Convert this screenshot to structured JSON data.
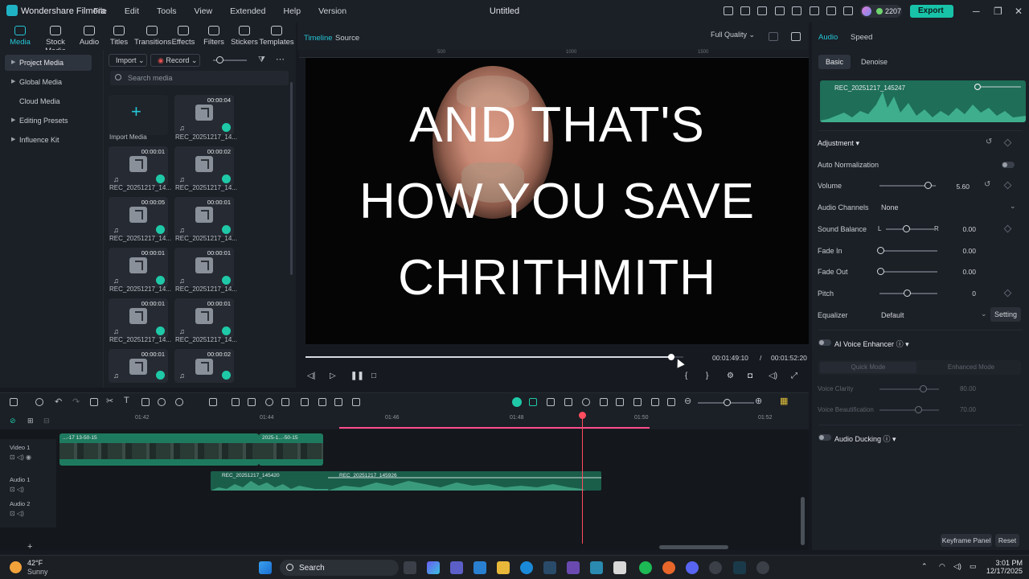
{
  "app": {
    "name": "Wondershare Filmora",
    "document_title": "Untitled",
    "menu": [
      "File",
      "Edit",
      "Tools",
      "View",
      "Extended",
      "Help",
      "Version"
    ],
    "credits": "2207",
    "export_label": "Export"
  },
  "toolbar": {
    "items": [
      "Media",
      "Stock Media",
      "Audio",
      "Titles",
      "Transitions",
      "Effects",
      "Filters",
      "Stickers",
      "Templates"
    ],
    "active": "Media"
  },
  "left_nav": {
    "items": [
      "Project Media",
      "Global Media",
      "Cloud Media",
      "Editing Presets",
      "Influence Kit"
    ]
  },
  "media": {
    "import_label": "Import",
    "record_label": "Record",
    "search_placeholder": "Search media",
    "import_tile_label": "Import Media",
    "tiles": [
      {
        "name": "REC_20251217_14...",
        "duration": "00:00:04"
      },
      {
        "name": "REC_20251217_14...",
        "duration": "00:00:01"
      },
      {
        "name": "REC_20251217_14...",
        "duration": "00:00:02"
      },
      {
        "name": "REC_20251217_14...",
        "duration": "00:00:05"
      },
      {
        "name": "REC_20251217_14...",
        "duration": "00:00:01"
      },
      {
        "name": "REC_20251217_14...",
        "duration": "00:00:01"
      },
      {
        "name": "REC_20251217_14...",
        "duration": "00:00:01"
      },
      {
        "name": "REC_20251217_14...",
        "duration": "00:00:01"
      },
      {
        "name": "REC_20251217_14...",
        "duration": "00:00:01"
      },
      {
        "name": "",
        "duration": "00:00:01"
      },
      {
        "name": "",
        "duration": "00:00:02"
      }
    ]
  },
  "preview": {
    "tabs": [
      "Timeline",
      "Source"
    ],
    "quality": "Full Quality",
    "ruler_marks": [
      "500",
      "1000",
      "1500"
    ],
    "caption_lines": [
      "AND THAT'S",
      "HOW YOU SAVE",
      "CHRITHMITH"
    ],
    "current_time": "00:01:49:10",
    "separator": "/",
    "total_time": "00:01:52:20",
    "progress_fraction": 0.97
  },
  "right_panel": {
    "tabs": [
      "Audio",
      "Speed"
    ],
    "subtabs": [
      "Basic",
      "Denoise"
    ],
    "clip_name": "REC_20251217_145247",
    "adjustment_label": "Adjustment",
    "auto_normalization": "Auto Normalization",
    "volume_label": "Volume",
    "volume_value": "5.60",
    "channels_label": "Audio Channels",
    "channels_value": "None",
    "balance_label": "Sound Balance",
    "balance_l": "L",
    "balance_r": "R",
    "balance_value": "0.00",
    "fadein_label": "Fade In",
    "fadein_value": "0.00",
    "fadeout_label": "Fade Out",
    "fadeout_value": "0.00",
    "pitch_label": "Pitch",
    "pitch_value": "0",
    "eq_label": "Equalizer",
    "eq_value": "Default",
    "eq_setting": "Setting",
    "ai_voice_label": "AI Voice Enhancer",
    "quick_mode": "Quick Mode",
    "enhanced_mode": "Enhanced Mode",
    "voice_clarity": "Voice Clarity",
    "voice_clarity_value": "80.00",
    "voice_beautify": "Voice Beautification",
    "voice_beautify_value": "70.00",
    "ducking_label": "Audio Ducking",
    "keyframe_panel": "Keyframe Panel",
    "reset": "Reset"
  },
  "timeline": {
    "ruler": [
      "01:42",
      "01:44",
      "01:46",
      "01:48",
      "01:50",
      "01:52"
    ],
    "tracks": [
      "Video 1",
      "Audio 1",
      "Audio 2"
    ],
    "video_clips": [
      "...-17 13-50-15",
      "2025-1...-50-15"
    ],
    "audio_clips": [
      "REC_20251217_145420",
      "REC_20251217_145926"
    ]
  },
  "taskbar": {
    "temperature": "42°F",
    "weather": "Sunny",
    "search": "Search",
    "time": "3:01 PM",
    "date": "12/17/2025"
  },
  "colors": {
    "accent": "#24c6d6",
    "export": "#18c2a8",
    "playhead": "#ff4d5e",
    "clip_green": "#1e7a5e"
  }
}
